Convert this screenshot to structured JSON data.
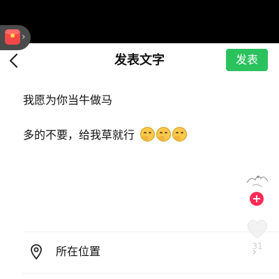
{
  "header": {
    "title": "发表文字",
    "publish_label": "发表",
    "accent_color": "#2bc25e"
  },
  "post": {
    "lines": [
      "我愿为你当牛做马",
      "多的不要，给我草就行"
    ],
    "emojis": [
      "thinking-face-emoji",
      "thinking-face-emoji",
      "thinking-face-emoji"
    ]
  },
  "side_panel": {
    "like_count": "31"
  },
  "location": {
    "label": "所在位置"
  }
}
